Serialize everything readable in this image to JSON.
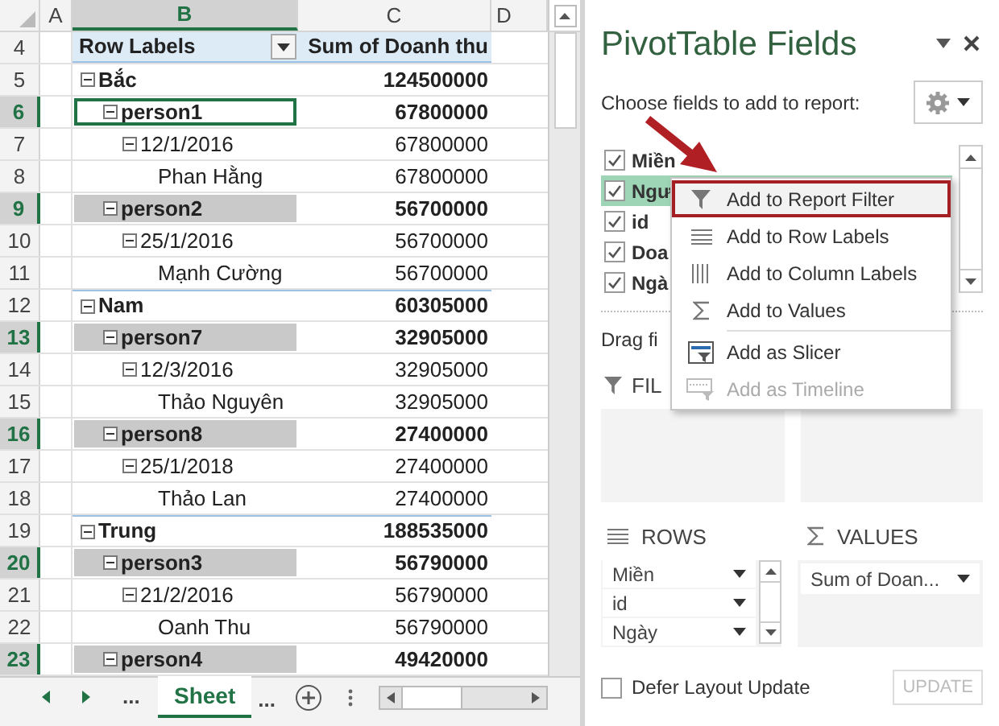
{
  "sheet": {
    "columns": [
      {
        "label": "A",
        "selected": false
      },
      {
        "label": "B",
        "selected": true
      },
      {
        "label": "C",
        "selected": false
      },
      {
        "label": "D",
        "selected": false
      }
    ],
    "header": {
      "row": "4",
      "label": "Row Labels",
      "value": "Sum of Doanh thu"
    },
    "rows": [
      {
        "row": "5",
        "kind": "region",
        "label": "Bắc",
        "value": "124500000",
        "selected": false,
        "active": false
      },
      {
        "row": "6",
        "kind": "person",
        "label": "person1",
        "value": "67800000",
        "selected": true,
        "active": true
      },
      {
        "row": "7",
        "kind": "date",
        "label": "12/1/2016",
        "value": "67800000",
        "selected": false,
        "active": false
      },
      {
        "row": "8",
        "kind": "name",
        "label": "Phan Hằng",
        "value": "67800000",
        "selected": false,
        "active": false
      },
      {
        "row": "9",
        "kind": "person",
        "label": "person2",
        "value": "56700000",
        "selected": true,
        "active": false
      },
      {
        "row": "10",
        "kind": "date",
        "label": "25/1/2016",
        "value": "56700000",
        "selected": false,
        "active": false
      },
      {
        "row": "11",
        "kind": "name",
        "label": "Mạnh Cường",
        "value": "56700000",
        "selected": false,
        "active": false
      },
      {
        "row": "12",
        "kind": "region",
        "label": "Nam",
        "value": "60305000",
        "selected": false,
        "active": false
      },
      {
        "row": "13",
        "kind": "person",
        "label": "person7",
        "value": "32905000",
        "selected": true,
        "active": false
      },
      {
        "row": "14",
        "kind": "date",
        "label": "12/3/2016",
        "value": "32905000",
        "selected": false,
        "active": false
      },
      {
        "row": "15",
        "kind": "name",
        "label": "Thảo Nguyên",
        "value": "32905000",
        "selected": false,
        "active": false
      },
      {
        "row": "16",
        "kind": "person",
        "label": "person8",
        "value": "27400000",
        "selected": true,
        "active": false
      },
      {
        "row": "17",
        "kind": "date",
        "label": "25/1/2018",
        "value": "27400000",
        "selected": false,
        "active": false
      },
      {
        "row": "18",
        "kind": "name",
        "label": "Thảo Lan",
        "value": "27400000",
        "selected": false,
        "active": false
      },
      {
        "row": "19",
        "kind": "region",
        "label": "Trung",
        "value": "188535000",
        "selected": false,
        "active": false
      },
      {
        "row": "20",
        "kind": "person",
        "label": "person3",
        "value": "56790000",
        "selected": true,
        "active": false
      },
      {
        "row": "21",
        "kind": "date",
        "label": "21/2/2016",
        "value": "56790000",
        "selected": false,
        "active": false
      },
      {
        "row": "22",
        "kind": "name",
        "label": "Oanh Thu",
        "value": "56790000",
        "selected": false,
        "active": false
      },
      {
        "row": "23",
        "kind": "person",
        "label": "person4",
        "value": "49420000",
        "selected": true,
        "active": false
      }
    ],
    "tabs_bar": {
      "left_more": "...",
      "tab": "Sheet",
      "right_more": "..."
    }
  },
  "pane": {
    "title": "PivotTable Fields",
    "subtitle": "Choose fields to add to report:",
    "fields": [
      {
        "label": "Miền",
        "checked": true,
        "selected": false
      },
      {
        "label": "Ngư",
        "checked": true,
        "selected": true
      },
      {
        "label": "id",
        "checked": true,
        "selected": false
      },
      {
        "label": "Doa",
        "checked": true,
        "selected": false
      },
      {
        "label": "Ngà",
        "checked": true,
        "selected": false
      }
    ],
    "drag_hint": "Drag fi",
    "filters_label": "FIL",
    "rows_label": "ROWS",
    "values_label": "VALUES",
    "rows_items": [
      "Miền",
      "id",
      "Ngày"
    ],
    "values_items": [
      "Sum of Doan..."
    ],
    "defer": {
      "label": "Defer Layout Update",
      "checked": false
    },
    "update_button": "UPDATE"
  },
  "context_menu": [
    {
      "kind": "filter",
      "label": "Add to Report Filter",
      "selected": true,
      "disabled": false
    },
    {
      "kind": "rows",
      "label": "Add to Row Labels",
      "selected": false,
      "disabled": false
    },
    {
      "kind": "columns",
      "label": "Add to Column Labels",
      "selected": false,
      "disabled": false
    },
    {
      "kind": "values",
      "label": "Add to Values",
      "selected": false,
      "disabled": false
    },
    {
      "kind": "slicer",
      "label": "Add as Slicer",
      "selected": false,
      "disabled": false
    },
    {
      "kind": "timeline",
      "label": "Add as Timeline",
      "selected": false,
      "disabled": true
    }
  ]
}
